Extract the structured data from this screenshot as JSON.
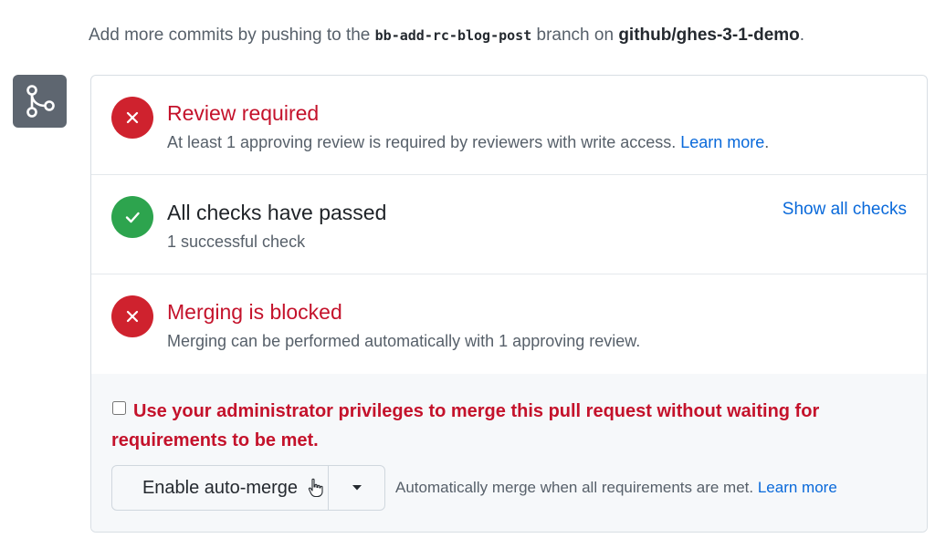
{
  "header_note": {
    "prefix": "Add more commits by pushing to the ",
    "branch": "bb-add-rc-blog-post",
    "middle": " branch on ",
    "repo": "github/ghes-3-1-demo",
    "suffix": "."
  },
  "sections": {
    "review": {
      "title": "Review required",
      "desc": "At least 1 approving review is required by reviewers with write access. ",
      "link": "Learn more",
      "suffix": "."
    },
    "checks": {
      "title": "All checks have passed",
      "desc": "1 successful check",
      "action": "Show all checks"
    },
    "merging": {
      "title": "Merging is blocked",
      "desc": "Merging can be performed automatically with 1 approving review."
    }
  },
  "admin": {
    "checkbox_checked": false,
    "text": "Use your administrator privileges to merge this pull request without waiting for requirements to be met."
  },
  "merge": {
    "button_label": "Enable auto-merge",
    "note": "Automatically merge when all requirements are met. ",
    "link": "Learn more"
  },
  "colors": {
    "error": "#cf222e",
    "success": "#2da44e",
    "link": "#0969da",
    "badge": "#5e6670"
  },
  "icons": {
    "branch_badge": "git-merge-icon",
    "review_status": "x-circle-icon",
    "checks_status": "check-circle-icon",
    "merging_status": "x-circle-icon",
    "merge_dropdown": "triangle-down-icon",
    "cursor": "hand-pointer-icon"
  }
}
